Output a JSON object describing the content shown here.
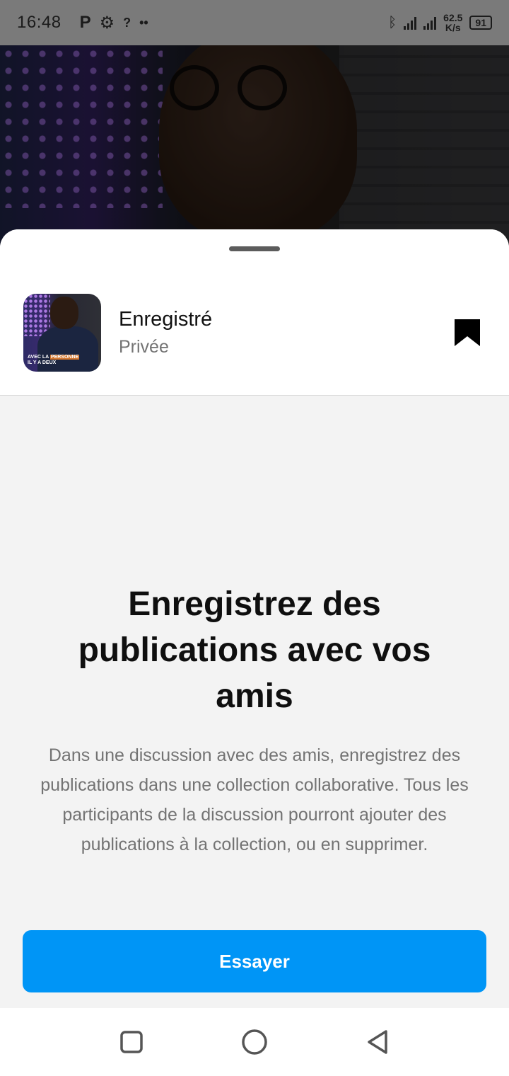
{
  "status_bar": {
    "time": "16:48",
    "icons": [
      "p-icon",
      "gear-icon",
      "wifi-question-icon",
      "dots-icon"
    ],
    "speed_value": "62.5",
    "speed_unit": "K/s",
    "battery": "91"
  },
  "saved": {
    "title": "Enregistré",
    "subtitle": "Privée",
    "thumb_caption_a": "AVEC LA",
    "thumb_caption_b": "PERSONNE",
    "thumb_caption_c": "IL Y A DEUX"
  },
  "promo": {
    "headline": "Enregistrez des publications avec vos amis",
    "description": "Dans une discussion avec des amis, enregistrez des publications dans une collection collaborative. Tous les participants de la discussion pourront ajouter des publications à la collection, ou en supprimer.",
    "button_label": "Essayer"
  },
  "colors": {
    "accent": "#0095f6",
    "secondary_text": "#737373"
  }
}
